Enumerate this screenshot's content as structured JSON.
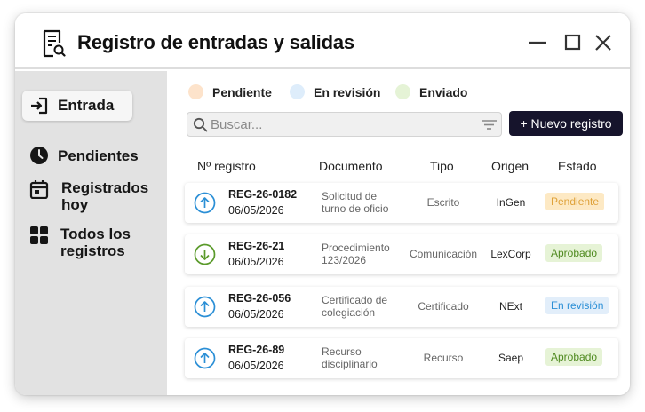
{
  "app": {
    "title": "Registro de entradas y salidas"
  },
  "sidebar": {
    "items": [
      {
        "label": "Entrada"
      },
      {
        "label": "Pendientes"
      },
      {
        "label": "Registrados hoy"
      },
      {
        "label": "Todos los registros"
      }
    ]
  },
  "legend": [
    {
      "label": "Pendiente",
      "color": "#fde3cb"
    },
    {
      "label": "En revisión",
      "color": "#deedfb"
    },
    {
      "label": "Enviado",
      "color": "#e5f3d6"
    }
  ],
  "search": {
    "placeholder": "Buscar...",
    "value": ""
  },
  "toolbar": {
    "new_label": "+ Nuevo registro"
  },
  "table": {
    "headers": [
      "Nº registro",
      "Documento",
      "Tipo",
      "Origen",
      "Estado"
    ],
    "rows": [
      {
        "direction": "up",
        "id": "REG-26-0182",
        "date": "06/05/2026",
        "documento": "Solicitud de turno de oficio",
        "tipo": "Escrito",
        "origen": "InGen",
        "estado": "Pendiente"
      },
      {
        "direction": "down",
        "id": "REG-26-21",
        "date": "06/05/2026",
        "documento": "Procedimiento 123/2026",
        "tipo": "Comunicación",
        "origen": "LexCorp",
        "estado": "Aprobado"
      },
      {
        "direction": "up",
        "id": "REG-26-056",
        "date": "06/05/2026",
        "documento": "Certificado de colegiación",
        "tipo": "Certificado",
        "origen": "NExt",
        "estado": "En revisión"
      },
      {
        "direction": "up",
        "id": "REG-26-89",
        "date": "06/05/2026",
        "documento": "Recurso disciplinario",
        "tipo": "Recurso",
        "origen": "Saep",
        "estado": "Aprobado"
      }
    ]
  },
  "colors": {
    "up_icon": "#2b8fd6",
    "down_icon": "#5a9a2a",
    "pendiente_bg": "#fde9c4",
    "pendiente_fg": "#dfa23a",
    "aprobado_bg": "#e6f3d6",
    "aprobado_fg": "#4f8a1f",
    "revision_bg": "#e2eefa",
    "revision_fg": "#2b8fd6"
  }
}
